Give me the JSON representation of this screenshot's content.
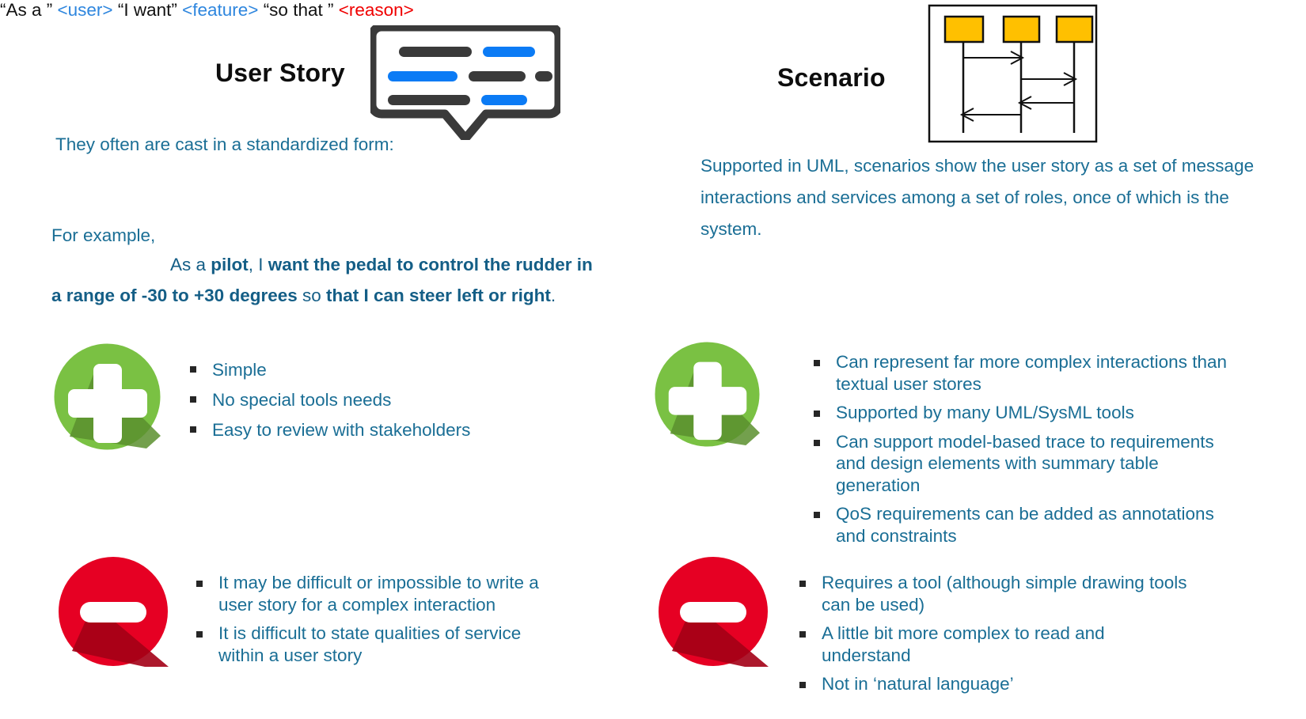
{
  "slide": {
    "left_column": {
      "title": "User Story",
      "icon": "speech-bubble-icon",
      "intro_line": "They often are cast in a standardized form:",
      "template": {
        "seg1": "“As a ” ",
        "seg2": "<user>",
        "seg3": " “I want” ",
        "seg4": "<feature>",
        "seg5": " “so that ” ",
        "seg6": "<reason>"
      },
      "for_example_label": "For example,",
      "example": {
        "p1_regular": "As a ",
        "p2_bold": "pilot",
        "p3_regular": ", I ",
        "p4_bold": "want the pedal to control the rudder in a range of -30 to +30 degrees",
        "p5_regular": " so ",
        "p6_bold": "that I can steer left or right",
        "p7_regular": "."
      },
      "pros": [
        "Simple",
        "No special tools needs",
        "Easy to review with stakeholders"
      ],
      "cons": [
        "It may be difficult or impossible to write a user story for a complex interaction",
        "It is difficult to state qualities of service within a user story"
      ]
    },
    "right_column": {
      "title": "Scenario",
      "icon": "sequence-diagram-icon",
      "description": "Supported in UML, scenarios show the user story as a set of message interactions and services among a set of roles, once of which is the system.",
      "pros": [
        "Can represent far more complex interactions than textual user stores",
        "Supported by many UML/SysML tools",
        "Can support model-based trace to requirements and design elements with summary table generation",
        "QoS requirements can be added as annotations and constraints"
      ],
      "cons": [
        "Requires a tool (although simple drawing tools can be used)",
        "A little bit more complex to read and understand",
        "Not in ‘natural language’"
      ]
    },
    "colors": {
      "body_text": "#1a6e95",
      "example_text": "#145e86",
      "template_blue": "#2e86de",
      "template_red": "#f00000",
      "title_black": "#0d0d0d",
      "pro_green": "#7ac143",
      "pro_green_shadow": "#5a8f2e",
      "con_red": "#e60023",
      "con_red_shadow": "#a30016",
      "bubble_dark": "#3a3a3a",
      "bubble_blue": "#0b7bf5",
      "seq_box_fill": "#ffc000",
      "seq_line": "#111111"
    }
  }
}
